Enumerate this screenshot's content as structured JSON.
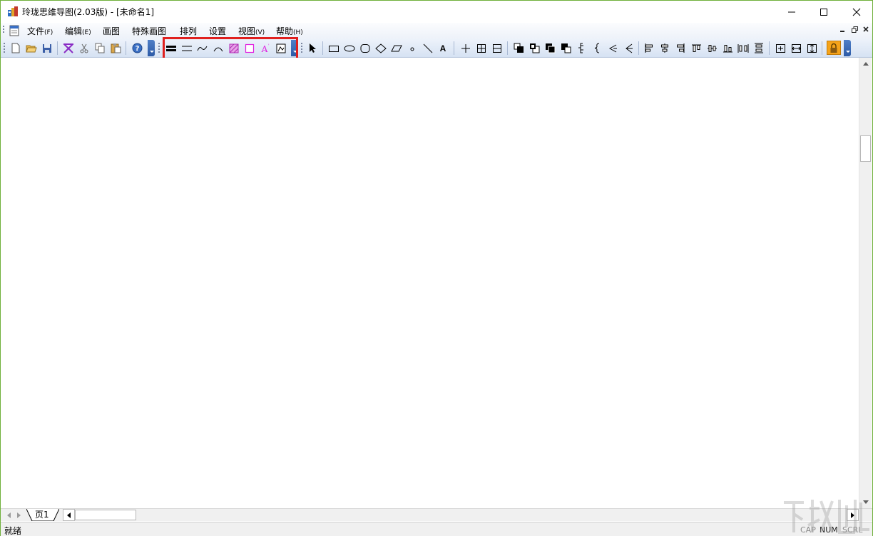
{
  "window": {
    "title": "玲珑思维导图(2.03版) - [未命名1]"
  },
  "menubar": {
    "items": [
      {
        "label": "文件",
        "accel": "(F)"
      },
      {
        "label": "编辑",
        "accel": "(E)"
      },
      {
        "label": "画图",
        "accel": ""
      },
      {
        "label": "特殊画图",
        "accel": ""
      },
      {
        "label": "排列",
        "accel": ""
      },
      {
        "label": "设置",
        "accel": ""
      },
      {
        "label": "视图",
        "accel": "(V)"
      },
      {
        "label": "帮助",
        "accel": "(H)"
      }
    ]
  },
  "toolbar": {
    "text_tool_glyph": "A",
    "text_effect_glyph": "A"
  },
  "tabs": {
    "page1": "页1"
  },
  "status": {
    "text": "就绪",
    "cap": "CAP",
    "num": "NUM",
    "scrl": "SCRL"
  },
  "colors": {
    "highlight": "#e0201e",
    "window_border": "#6fb03a",
    "toolbar_chevron": "#2c5aa6"
  }
}
